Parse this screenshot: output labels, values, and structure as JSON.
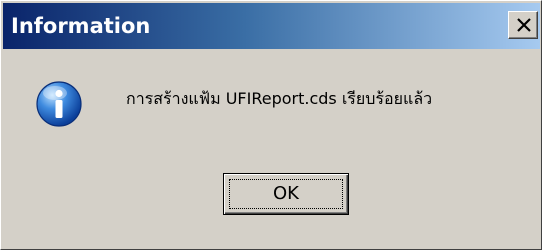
{
  "dialog": {
    "title": "Information",
    "message": "การสร้างแฟ้ม UFIReport.cds เรียบร้อยแล้ว",
    "ok_label": "OK",
    "icon": "info-icon",
    "close_icon": "close-icon"
  },
  "colors": {
    "titlebar_start": "#0a246a",
    "titlebar_end": "#a6caf0",
    "face": "#d4d0c8",
    "info_blue": "#1f5fbf"
  }
}
